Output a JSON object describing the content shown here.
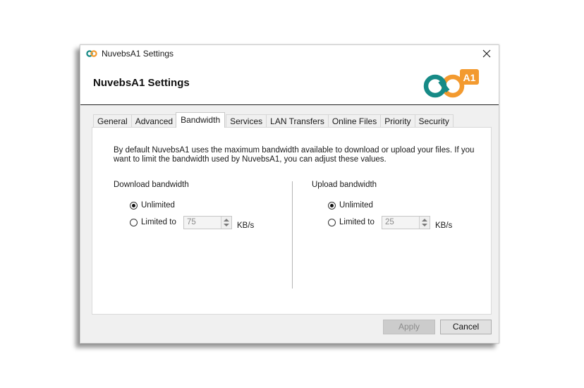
{
  "window": {
    "title": "NuvebsA1 Settings",
    "close_symbol": "✕"
  },
  "header": {
    "title": "NuvebsA1 Settings",
    "logo_text": "A1",
    "logo_colors": {
      "teal": "#168a86",
      "orange": "#f39a2f"
    }
  },
  "tabs": [
    {
      "label": "General",
      "active": false
    },
    {
      "label": "Advanced",
      "active": false
    },
    {
      "label": "Bandwidth",
      "active": true
    },
    {
      "label": "Services",
      "active": false
    },
    {
      "label": "LAN Transfers",
      "active": false
    },
    {
      "label": "Online Files",
      "active": false
    },
    {
      "label": "Priority",
      "active": false
    },
    {
      "label": "Security",
      "active": false
    }
  ],
  "bandwidth": {
    "description": "By default NuvebsA1 uses the maximum bandwidth available to download or upload your files. If you want to limit the bandwidth used by NuvebsA1, you can adjust these values.",
    "download": {
      "label": "Download bandwidth",
      "unlimited_label": "Unlimited",
      "limited_label": "Limited to",
      "selected": "unlimited",
      "value": "75",
      "unit": "KB/s"
    },
    "upload": {
      "label": "Upload bandwidth",
      "unlimited_label": "Unlimited",
      "limited_label": "Limited to",
      "selected": "unlimited",
      "value": "25",
      "unit": "KB/s"
    }
  },
  "buttons": {
    "apply": "Apply",
    "cancel": "Cancel"
  }
}
